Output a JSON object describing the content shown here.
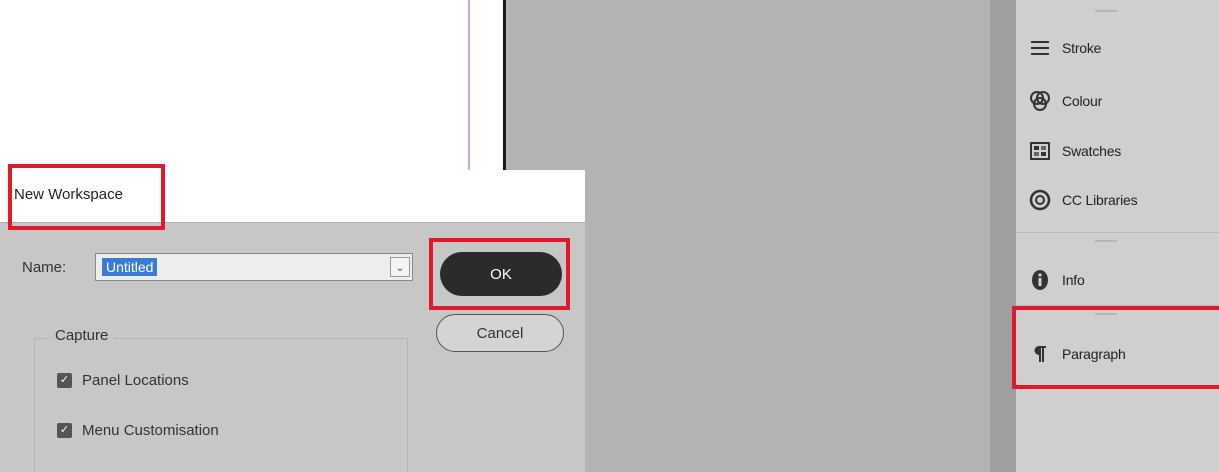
{
  "dialog": {
    "title": "New Workspace",
    "name_label": "Name:",
    "name_value": "Untitled",
    "capture": {
      "label": "Capture",
      "options": [
        {
          "label": "Panel Locations",
          "checked": true
        },
        {
          "label": "Menu Customisation",
          "checked": true
        }
      ]
    },
    "ok_label": "OK",
    "cancel_label": "Cancel"
  },
  "panels": {
    "items": [
      {
        "label": "Stroke",
        "icon": "stroke-icon"
      },
      {
        "label": "Colour",
        "icon": "colour-icon"
      },
      {
        "label": "Swatches",
        "icon": "swatches-icon"
      },
      {
        "label": "CC Libraries",
        "icon": "cc-libraries-icon"
      },
      {
        "label": "Info",
        "icon": "info-icon"
      },
      {
        "label": "Paragraph",
        "icon": "paragraph-icon"
      }
    ]
  },
  "colors": {
    "highlight": "#e0192b",
    "ok_button": "#2b2b2b",
    "selection": "#3a7bd5",
    "pasteboard": "#b3b3b3",
    "panel_bg": "#cfcfcf"
  }
}
